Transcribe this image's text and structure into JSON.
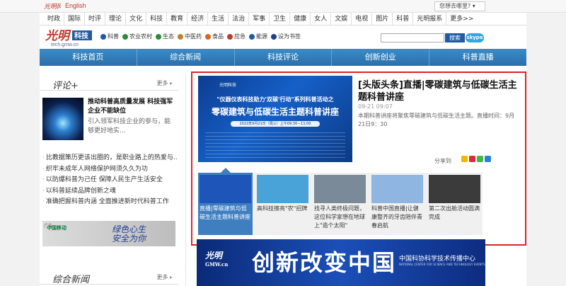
{
  "topbar": {
    "logo_text": "光明网",
    "lang_link": "English",
    "where_prompt": "您想去哪里?"
  },
  "channels": [
    "时政",
    "国际",
    "时评",
    "理论",
    "文化",
    "科技",
    "教育",
    "经济",
    "生活",
    "法治",
    "军事",
    "卫生",
    "健康",
    "女人",
    "文娱",
    "电视",
    "图片",
    "科普",
    "光明报系",
    "更多>>"
  ],
  "brand": {
    "logo_text": "光明",
    "badge": "科技",
    "subtitle": "tech.gmw.cn"
  },
  "quick_links": [
    {
      "label": "科普",
      "color": "#1f5aa6"
    },
    {
      "label": "农业农村",
      "color": "#2d8a3a"
    },
    {
      "label": "生态",
      "color": "#2d8a3a"
    },
    {
      "label": "中医药",
      "color": "#b8862b"
    },
    {
      "label": "食品",
      "color": "#d2691e"
    },
    {
      "label": "应急",
      "color": "#c0392b"
    },
    {
      "label": "能源",
      "color": "#1f5aa6"
    },
    {
      "label": "设为书签",
      "color": "#1f3f8f"
    }
  ],
  "search": {
    "button_label": "搜索",
    "skype_label": "skype"
  },
  "main_nav": [
    "科技首页",
    "综合新闻",
    "科技评论",
    "创新创业",
    "科普直播"
  ],
  "commentary": {
    "section_title": "评论+",
    "more_label": "更多",
    "feature": {
      "title": "推动科普高质量发展 科技强军企业不能缺位",
      "desc": "引入领军科技企业的参与，能够更好地实..."
    },
    "items": [
      "比教据策历更该出圈的，是职业路上的热爱与...",
      "织牢未成年人网络保护网须久久为功",
      "以防爆科普为己任 保障人民生产生活安全",
      "以科普延续品牌创新之魂",
      "准确把握科普内涵 全面推进新时代科普工作"
    ],
    "ad": {
      "tag": "广告",
      "brand": "中国移动",
      "slogan_line1": "绿色心生",
      "slogan_line2": "安全为你"
    }
  },
  "general_news": {
    "section_title": "综合新闻",
    "more_label": "更多"
  },
  "headline": {
    "image": {
      "org": "光明科技",
      "kicker": "\"仪器仪表科技助力'双碳'行动\"系列科普活动之",
      "main": "零碳建筑与低碳生活主题科普讲座",
      "date_line": "2022年9月21日（周三）上午09:30—11:00"
    },
    "title": "[头版头条]直播|零碳建筑与低碳生活主题科普讲座",
    "date": "09-21 09:07",
    "summary": "本期科普讲座将聚焦零碳建筑与低碳生活主题。直播时间：9月21日9：30",
    "share_label": "分享到"
  },
  "thumbnails": [
    {
      "title": "直播|零碳建筑与低碳生活主题科普讲座",
      "active": true,
      "color": "#1d56b8"
    },
    {
      "title": "高科技擦亮\"农\"招牌",
      "active": false,
      "color": "#4aa3d8"
    },
    {
      "title": "找寻人类终极问题，这位科学家想在地球上\"造个太阳\"",
      "active": false,
      "color": "#7a8a99"
    },
    {
      "title": "科普中国直播|让健康整齐的牙齿陪伴青春启航",
      "active": false,
      "color": "#8fb6e0"
    },
    {
      "title": "第二次出舱活动圆满完成",
      "active": false,
      "color": "#3b3b3b"
    }
  ],
  "banner": {
    "logo_text": "光明",
    "logo_sub": "GMW.cn",
    "title": "创新改变中国",
    "org": "中国科协科学技术传播中心",
    "org_en": "NATIONAL CENTER FOR SCIENCE AND TECHNOLOGY EVENTS"
  }
}
